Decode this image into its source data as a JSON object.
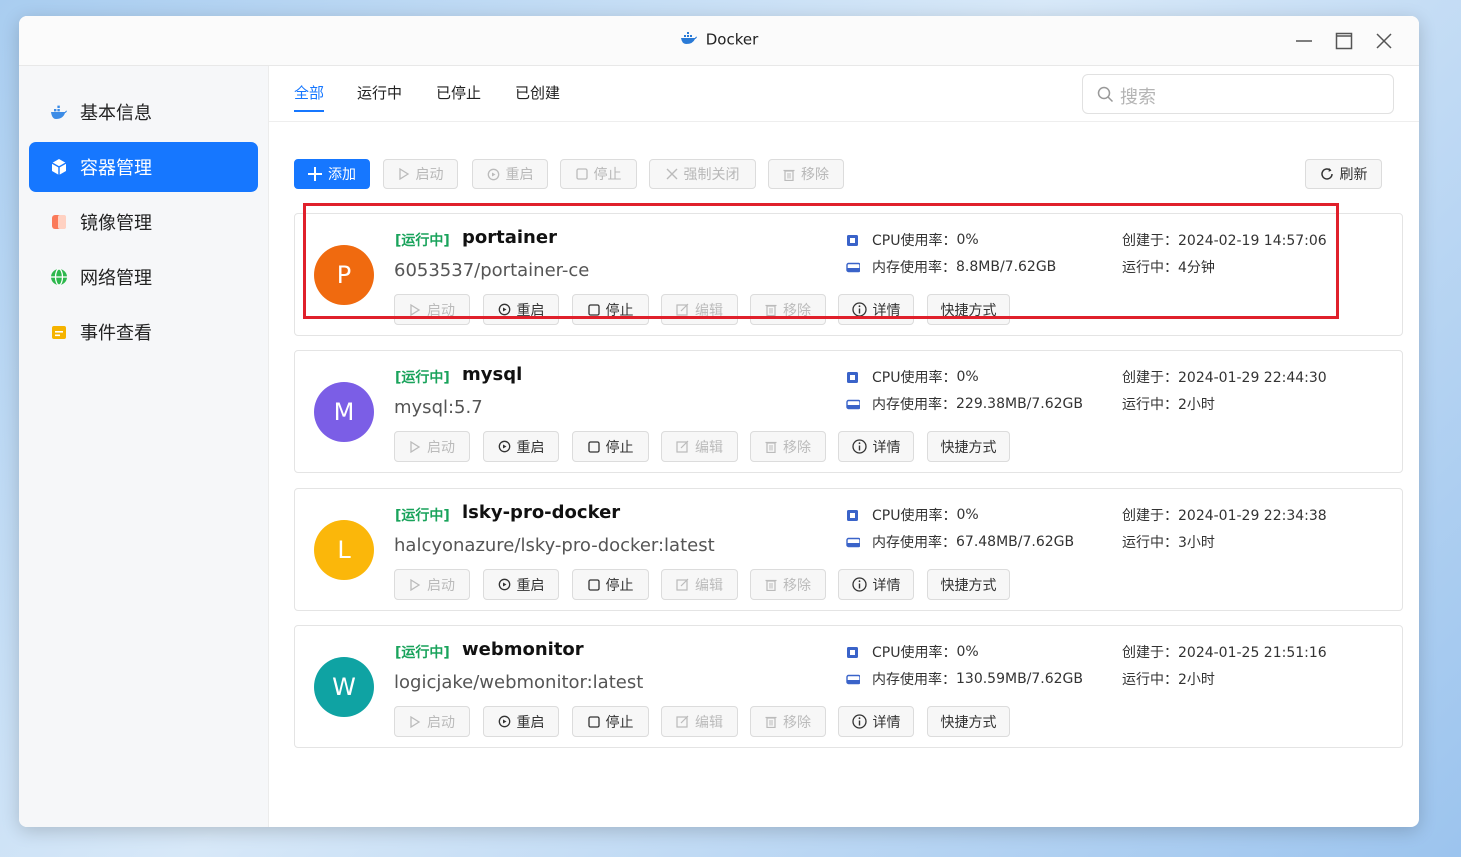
{
  "window": {
    "title": "Docker"
  },
  "sidebar": {
    "items": [
      {
        "label": "基本信息",
        "icon": "whale-icon",
        "active": false
      },
      {
        "label": "容器管理",
        "icon": "cube-icon",
        "active": true
      },
      {
        "label": "镜像管理",
        "icon": "image-icon",
        "active": false
      },
      {
        "label": "网络管理",
        "icon": "globe-icon",
        "active": false
      },
      {
        "label": "事件查看",
        "icon": "event-icon",
        "active": false
      }
    ]
  },
  "tabs": [
    {
      "label": "全部",
      "active": true
    },
    {
      "label": "运行中",
      "active": false
    },
    {
      "label": "已停止",
      "active": false
    },
    {
      "label": "已创建",
      "active": false
    }
  ],
  "search": {
    "placeholder": "搜索"
  },
  "toolbar": {
    "add": "添加",
    "start": "启动",
    "restart": "重启",
    "stop": "停止",
    "force_close": "强制关闭",
    "remove": "移除",
    "refresh": "刷新"
  },
  "card_buttons": {
    "start": "启动",
    "restart": "重启",
    "stop": "停止",
    "edit": "编辑",
    "remove": "移除",
    "details": "详情",
    "shortcut": "快捷方式"
  },
  "labels": {
    "cpu": "CPU使用率：",
    "mem": "内存使用率：",
    "created": "创建于：",
    "uptime": "运行中："
  },
  "containers": [
    {
      "initial": "P",
      "color": "#f06a0f",
      "status": "[运行中]",
      "name": "portainer",
      "image": "6053537/portainer-ce",
      "cpu": "0%",
      "mem": "8.8MB/7.62GB",
      "created": "2024-02-19 14:57:06",
      "uptime": "4分钟"
    },
    {
      "initial": "M",
      "color": "#7b5ee6",
      "status": "[运行中]",
      "name": "mysql",
      "image": "mysql:5.7",
      "cpu": "0%",
      "mem": "229.38MB/7.62GB",
      "created": "2024-01-29 22:44:30",
      "uptime": "2小时"
    },
    {
      "initial": "L",
      "color": "#fbb70a",
      "status": "[运行中]",
      "name": "lsky-pro-docker",
      "image": "halcyonazure/lsky-pro-docker:latest",
      "cpu": "0%",
      "mem": "67.48MB/7.62GB",
      "created": "2024-01-29 22:34:38",
      "uptime": "3小时"
    },
    {
      "initial": "W",
      "color": "#0fa3a3",
      "status": "[运行中]",
      "name": "webmonitor",
      "image": "logicjake/webmonitor:latest",
      "cpu": "0%",
      "mem": "130.59MB/7.62GB",
      "created": "2024-01-25 21:51:16",
      "uptime": "2小时"
    }
  ],
  "colors": {
    "accent": "#1677ff",
    "running": "#19a35b",
    "highlight_border": "#e0202b"
  }
}
